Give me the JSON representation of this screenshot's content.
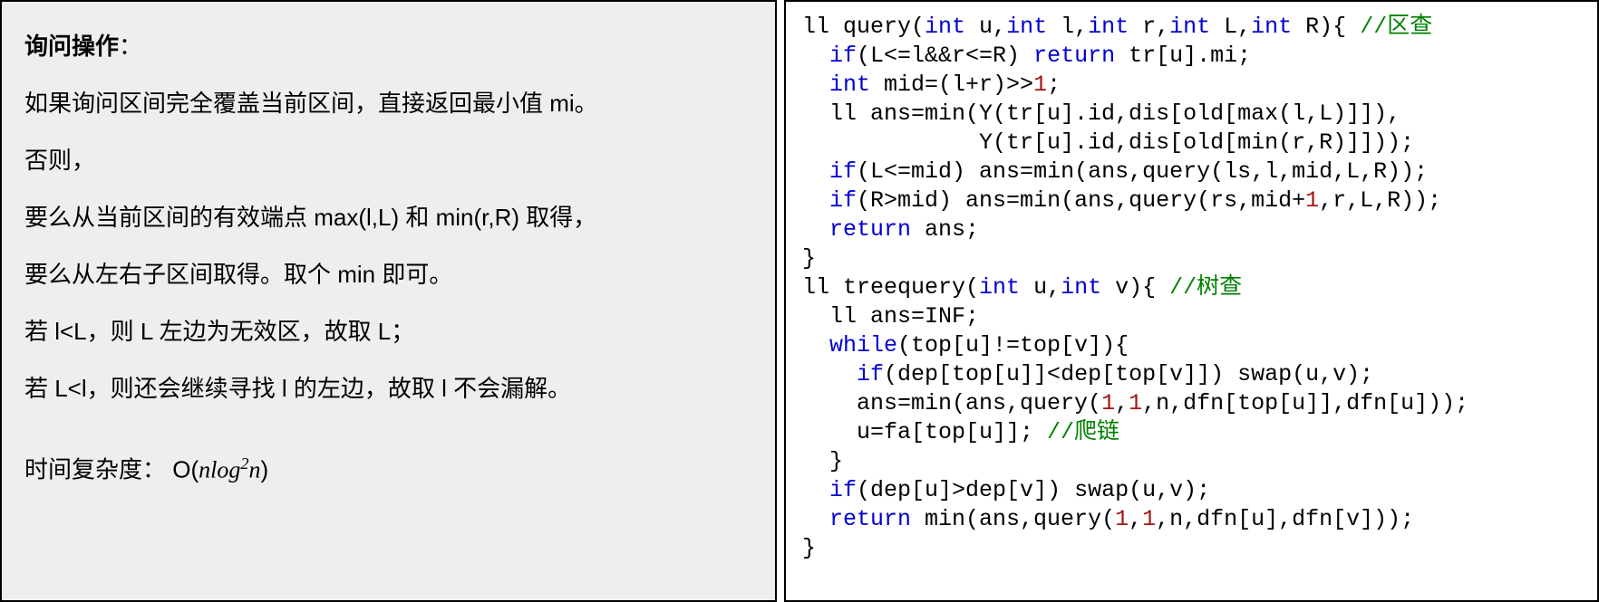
{
  "left": {
    "title": "询问操作",
    "title_colon": "：",
    "p1": "如果询问区间完全覆盖当前区间，直接返回最小值 mi。",
    "p2": "否则，",
    "p3": "要么从当前区间的有效端点 max(l,L) 和 min(r,R) 取得，",
    "p4": "要么从左右子区间取得。取个 min 即可。",
    "p5": "若 l<L，则 L 左边为无效区，故取 L；",
    "p6": "若 L<l，则还会继续寻找 l 的左边，故取 l 不会漏解。",
    "complexity_label": "时间复杂度：  O(",
    "complexity_expr_n": "n",
    "complexity_expr_log": "log",
    "complexity_expr_sup": "2",
    "complexity_expr_n2": "n",
    "complexity_close": ")"
  },
  "code": {
    "l1_a": "ll query(",
    "l1_kw1": "int",
    "l1_b": " u,",
    "l1_kw2": "int",
    "l1_c": " l,",
    "l1_kw3": "int",
    "l1_d": " r,",
    "l1_kw4": "int",
    "l1_e": " L,",
    "l1_kw5": "int",
    "l1_f": " R){ ",
    "l1_cm": "//区查",
    "l2_a": "  ",
    "l2_kw": "if",
    "l2_b": "(L<=l&&r<=R) ",
    "l2_kw2": "return",
    "l2_c": " tr[u].mi;",
    "l3_a": "  ",
    "l3_kw": "int",
    "l3_b": " mid=(l+r)>>",
    "l3_n": "1",
    "l3_c": ";",
    "l4": "  ll ans=min(Y(tr[u].id,dis[old[max(l,L)]]),",
    "l5": "             Y(tr[u].id,dis[old[min(r,R)]]));",
    "l6_a": "  ",
    "l6_kw": "if",
    "l6_b": "(L<=mid) ans=min(ans,query(ls,l,mid,L,R));",
    "l7_a": "  ",
    "l7_kw": "if",
    "l7_b": "(R>mid) ans=min(ans,query(rs,mid+",
    "l7_n": "1",
    "l7_c": ",r,L,R));",
    "l8_a": "  ",
    "l8_kw": "return",
    "l8_b": " ans;",
    "l9": "}",
    "l10_a": "ll treequery(",
    "l10_kw1": "int",
    "l10_b": " u,",
    "l10_kw2": "int",
    "l10_c": " v){ ",
    "l10_cm": "//树查",
    "l11": "  ll ans=INF;",
    "l12_a": "  ",
    "l12_kw": "while",
    "l12_b": "(top[u]!=top[v]){",
    "l13_a": "    ",
    "l13_kw": "if",
    "l13_b": "(dep[top[u]]<dep[top[v]]) swap(u,v);",
    "l14_a": "    ans=min(ans,query(",
    "l14_n1": "1",
    "l14_b": ",",
    "l14_n2": "1",
    "l14_c": ",n,dfn[top[u]],dfn[u]));",
    "l15_a": "    u=fa[top[u]]; ",
    "l15_cm": "//爬链",
    "l16": "  }",
    "l17_a": "  ",
    "l17_kw": "if",
    "l17_b": "(dep[u]>dep[v]) swap(u,v);",
    "l18_a": "  ",
    "l18_kw": "return",
    "l18_b": " min(ans,query(",
    "l18_n1": "1",
    "l18_c": ",",
    "l18_n2": "1",
    "l18_d": ",n,dfn[u],dfn[v]));",
    "l19": "}"
  }
}
